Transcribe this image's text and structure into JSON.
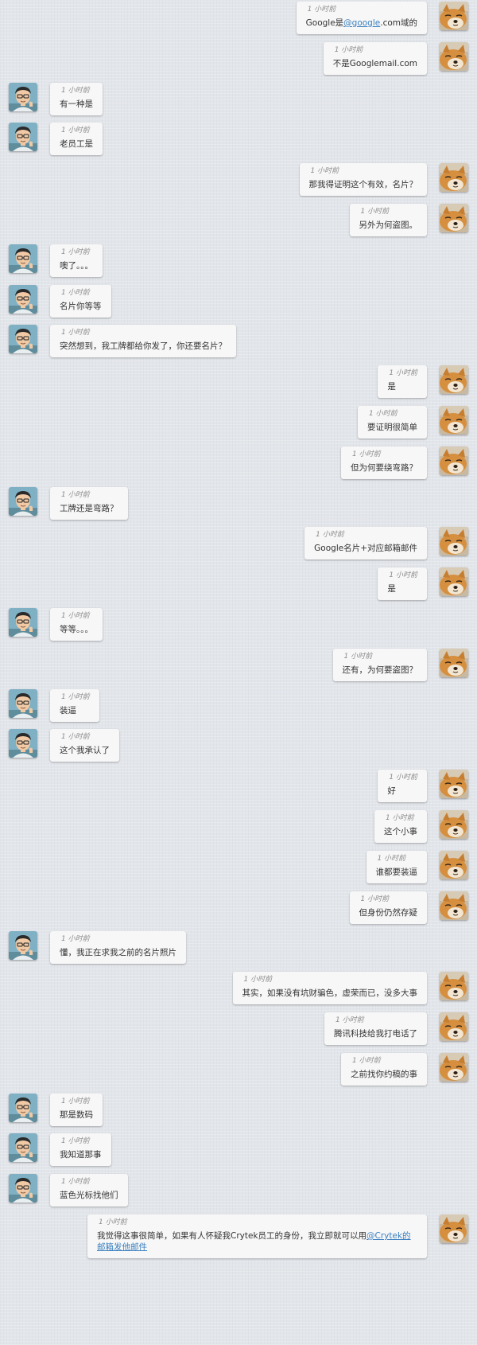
{
  "colors": {
    "background": "#e2e5ea",
    "bubble": "#f7f7f7",
    "text": "#333333",
    "timestamp": "#8c8c8c",
    "link": "#3a7fc0"
  },
  "avatars": {
    "self": "shiba-dog-avatar",
    "other": "cartoon-man-avatar"
  },
  "messages": [
    {
      "side": "right",
      "time": "1 小时前",
      "parts": [
        {
          "t": "Google是"
        },
        {
          "t": "@google",
          "link": true
        },
        {
          "t": ".com域的"
        }
      ]
    },
    {
      "side": "right",
      "time": "1 小时前",
      "parts": [
        {
          "t": "不是Googlemail.com"
        }
      ]
    },
    {
      "side": "left",
      "time": "1 小时前",
      "parts": [
        {
          "t": "有一种是"
        }
      ]
    },
    {
      "side": "left",
      "time": "1 小时前",
      "parts": [
        {
          "t": "老员工是"
        }
      ]
    },
    {
      "side": "right",
      "time": "1 小时前",
      "parts": [
        {
          "t": "那我得证明这个有效，名片？"
        }
      ]
    },
    {
      "side": "right",
      "time": "1 小时前",
      "parts": [
        {
          "t": "另外为何盗图。"
        }
      ]
    },
    {
      "side": "left",
      "time": "1 小时前",
      "parts": [
        {
          "t": "噢了。。。"
        }
      ]
    },
    {
      "side": "left",
      "time": "1 小时前",
      "parts": [
        {
          "t": "名片你等等"
        }
      ]
    },
    {
      "side": "left",
      "time": "1 小时前",
      "parts": [
        {
          "t": "突然想到，我工牌都给你发了，你还要名片？"
        }
      ]
    },
    {
      "side": "right",
      "time": "1 小时前",
      "parts": [
        {
          "t": "是"
        }
      ]
    },
    {
      "side": "right",
      "time": "1 小时前",
      "parts": [
        {
          "t": "要证明很简单"
        }
      ]
    },
    {
      "side": "right",
      "time": "1 小时前",
      "parts": [
        {
          "t": "但为何要绕弯路？"
        }
      ]
    },
    {
      "side": "left",
      "time": "1 小时前",
      "parts": [
        {
          "t": "工牌还是弯路？"
        }
      ]
    },
    {
      "side": "right",
      "time": "1 小时前",
      "parts": [
        {
          "t": "Google名片+对应邮箱邮件"
        }
      ]
    },
    {
      "side": "right",
      "time": "1 小时前",
      "parts": [
        {
          "t": "是"
        }
      ]
    },
    {
      "side": "left",
      "time": "1 小时前",
      "parts": [
        {
          "t": "等等。。。"
        }
      ]
    },
    {
      "side": "right",
      "time": "1 小时前",
      "parts": [
        {
          "t": "还有，为何要盗图？"
        }
      ]
    },
    {
      "side": "left",
      "time": "1 小时前",
      "parts": [
        {
          "t": "装逼"
        }
      ]
    },
    {
      "side": "left",
      "time": "1 小时前",
      "parts": [
        {
          "t": "这个我承认了"
        }
      ]
    },
    {
      "side": "right",
      "time": "1 小时前",
      "parts": [
        {
          "t": "好"
        }
      ]
    },
    {
      "side": "right",
      "time": "1 小时前",
      "parts": [
        {
          "t": "这个小事"
        }
      ]
    },
    {
      "side": "right",
      "time": "1 小时前",
      "parts": [
        {
          "t": "谁都要装逼"
        }
      ]
    },
    {
      "side": "right",
      "time": "1 小时前",
      "parts": [
        {
          "t": "但身份仍然存疑"
        }
      ]
    },
    {
      "side": "left",
      "time": "1 小时前",
      "parts": [
        {
          "t": "懂，我正在求我之前的名片照片"
        }
      ]
    },
    {
      "side": "right",
      "time": "1 小时前",
      "parts": [
        {
          "t": "其实，如果没有坑财骗色，虚荣而已，没多大事"
        }
      ]
    },
    {
      "side": "right",
      "time": "1 小时前",
      "parts": [
        {
          "t": "腾讯科技给我打电话了"
        }
      ]
    },
    {
      "side": "right",
      "time": "1 小时前",
      "parts": [
        {
          "t": "之前找你约稿的事"
        }
      ]
    },
    {
      "side": "left",
      "time": "1 小时前",
      "parts": [
        {
          "t": "那是数码"
        }
      ]
    },
    {
      "side": "left",
      "time": "1 小时前",
      "parts": [
        {
          "t": "我知道那事"
        }
      ]
    },
    {
      "side": "left",
      "time": "1 小时前",
      "parts": [
        {
          "t": "蓝色光标找他们"
        }
      ]
    },
    {
      "side": "right",
      "time": "1 小时前",
      "wide": true,
      "parts": [
        {
          "t": "我觉得这事很简单，如果有人怀疑我Crytek员工的身份，我立即就可以用"
        },
        {
          "t": "@Crytek的邮箱发他邮件",
          "link": true
        }
      ]
    }
  ]
}
